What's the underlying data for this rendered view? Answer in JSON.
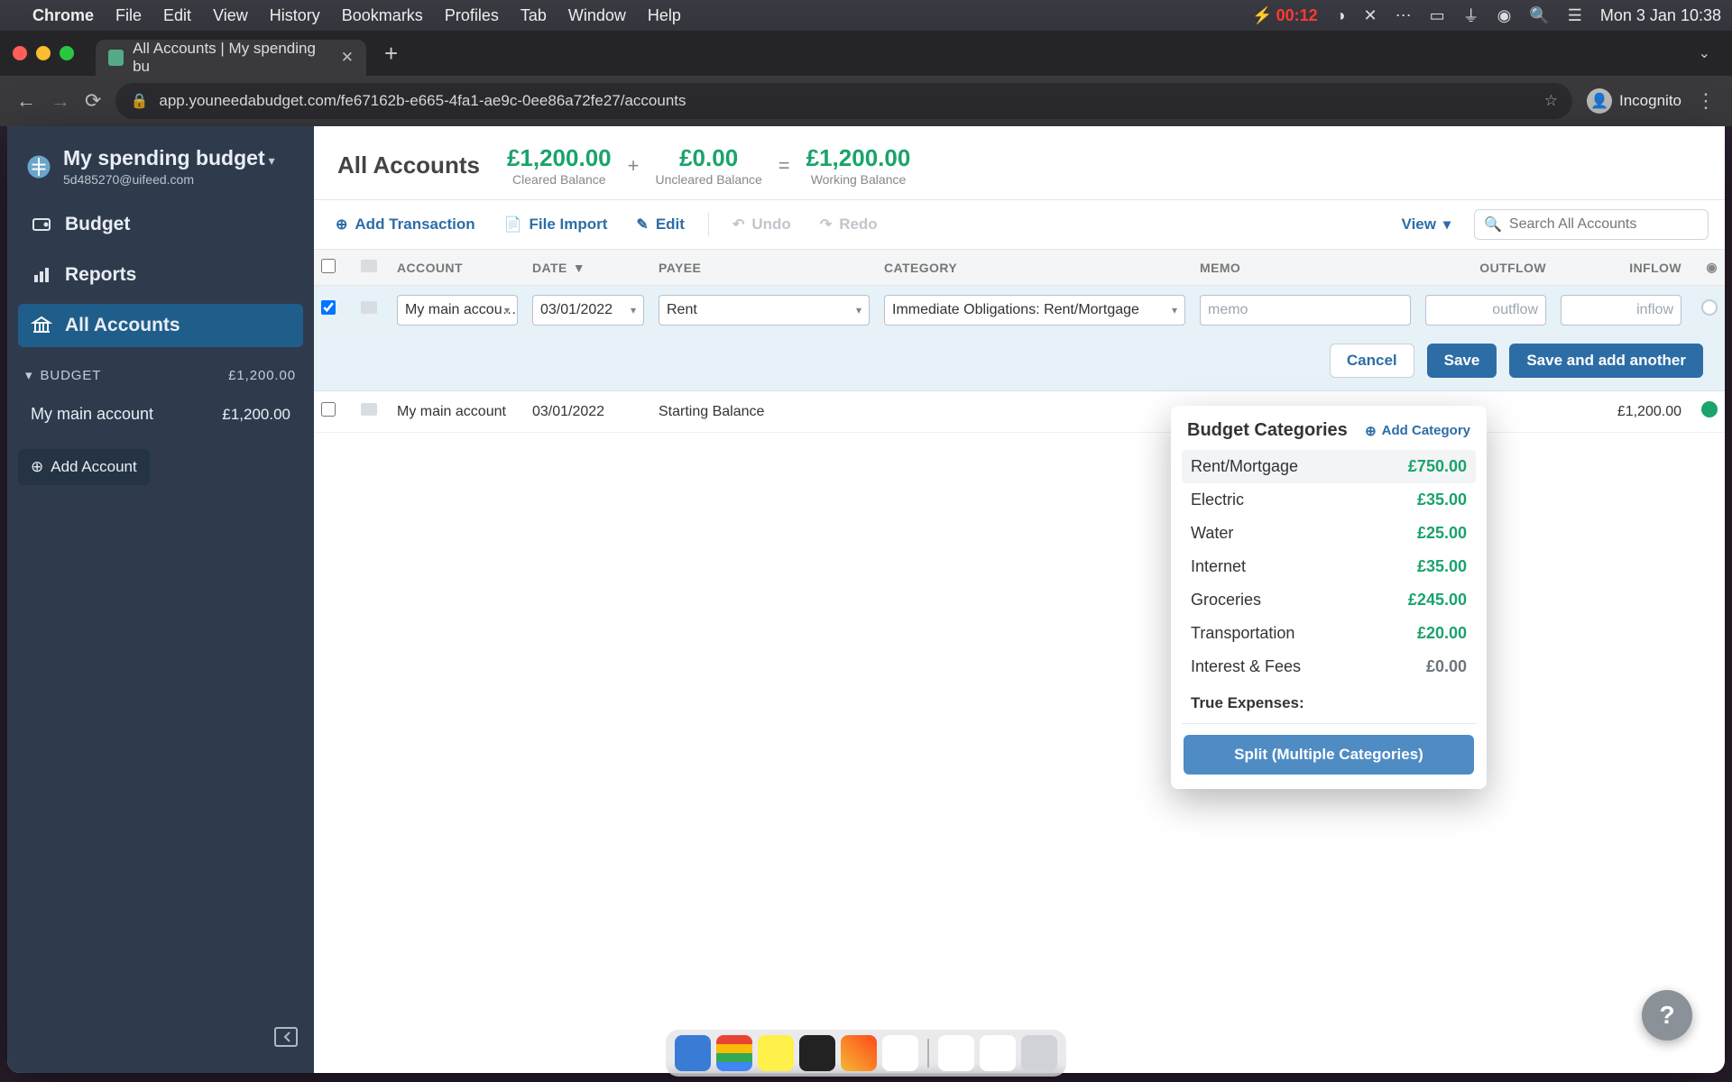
{
  "menubar": {
    "app": "Chrome",
    "items": [
      "File",
      "Edit",
      "View",
      "History",
      "Bookmarks",
      "Profiles",
      "Tab",
      "Window",
      "Help"
    ],
    "battery": "00:12",
    "clock": "Mon 3 Jan  10:38"
  },
  "browser": {
    "tab_title": "All Accounts | My spending bu",
    "url": "app.youneedabudget.com/fe67162b-e665-4fa1-ae9c-0ee86a72fe27/accounts",
    "incognito": "Incognito"
  },
  "sidebar": {
    "budget_name": "My spending budget",
    "email": "5d485270@uifeed.com",
    "nav": {
      "budget": "Budget",
      "reports": "Reports",
      "all_accounts": "All Accounts"
    },
    "section_label": "BUDGET",
    "section_total": "£1,200.00",
    "accounts": [
      {
        "name": "My main account",
        "balance": "£1,200.00"
      }
    ],
    "add_account": "Add Account"
  },
  "header": {
    "title": "All Accounts",
    "balances": {
      "cleared": {
        "value": "£1,200.00",
        "label": "Cleared Balance"
      },
      "uncleared": {
        "value": "£0.00",
        "label": "Uncleared Balance"
      },
      "working": {
        "value": "£1,200.00",
        "label": "Working Balance"
      }
    }
  },
  "toolbar": {
    "add": "Add Transaction",
    "import": "File Import",
    "edit": "Edit",
    "undo": "Undo",
    "redo": "Redo",
    "view": "View",
    "search_placeholder": "Search All Accounts"
  },
  "columns": {
    "account": "ACCOUNT",
    "date": "DATE",
    "payee": "PAYEE",
    "category": "CATEGORY",
    "memo": "MEMO",
    "outflow": "OUTFLOW",
    "inflow": "INFLOW"
  },
  "edit_row": {
    "account": "My main accou…",
    "date": "03/01/2022",
    "payee": "Rent",
    "category": "Immediate Obligations: Rent/Mortgage",
    "memo_placeholder": "memo",
    "outflow_placeholder": "outflow",
    "inflow_placeholder": "inflow"
  },
  "actions": {
    "cancel": "Cancel",
    "save": "Save",
    "save_another": "Save and add another"
  },
  "existing_row": {
    "account": "My main account",
    "date": "03/01/2022",
    "payee": "Starting Balance",
    "inflow": "£1,200.00"
  },
  "cat_popup": {
    "title": "Budget Categories",
    "add": "Add Category",
    "items": [
      {
        "name": "Rent/Mortgage",
        "amt": "£750.00"
      },
      {
        "name": "Electric",
        "amt": "£35.00"
      },
      {
        "name": "Water",
        "amt": "£25.00"
      },
      {
        "name": "Internet",
        "amt": "£35.00"
      },
      {
        "name": "Groceries",
        "amt": "£245.00"
      },
      {
        "name": "Transportation",
        "amt": "£20.00"
      },
      {
        "name": "Interest & Fees",
        "amt": "£0.00"
      }
    ],
    "group2": "True Expenses:",
    "split": "Split (Multiple Categories)"
  },
  "help_glyph": "?"
}
